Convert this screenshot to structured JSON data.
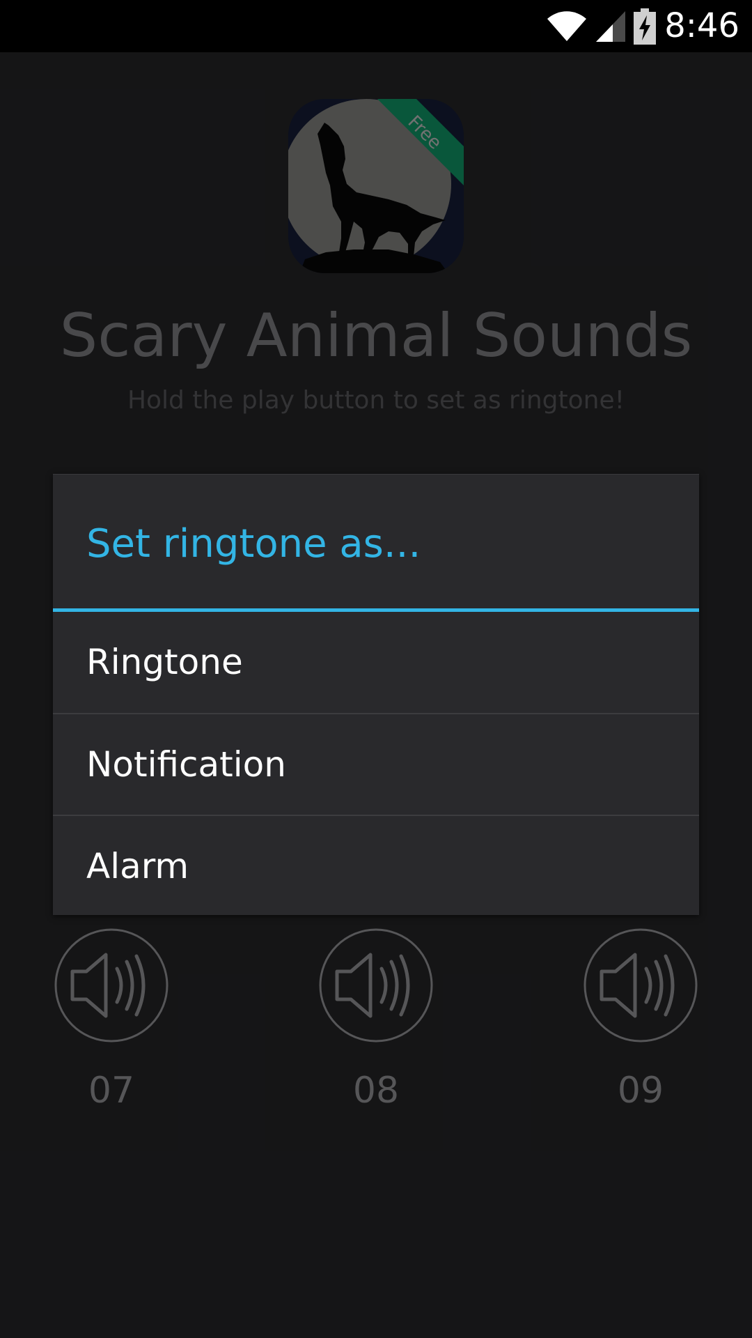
{
  "status_bar": {
    "time": "8:46"
  },
  "app": {
    "title": "Scary Animal Sounds",
    "subtitle": "Hold the play button to set as ringtone!",
    "icon_badge": "Free"
  },
  "sounds": [
    {
      "label": "07"
    },
    {
      "label": "08"
    },
    {
      "label": "09"
    }
  ],
  "dialog": {
    "title": "Set ringtone as...",
    "items": [
      {
        "label": "Ringtone"
      },
      {
        "label": "Notification"
      },
      {
        "label": "Alarm"
      }
    ]
  },
  "colors": {
    "accent": "#33b5e5",
    "badge": "#0b6b48",
    "background": "#1a1a1c",
    "dialog": "#29292c"
  },
  "icons": {
    "wifi": "wifi-icon",
    "signal": "cell-signal-icon",
    "battery": "battery-charging-icon",
    "sound": "speaker-icon",
    "wolf": "howling-wolf-icon"
  }
}
